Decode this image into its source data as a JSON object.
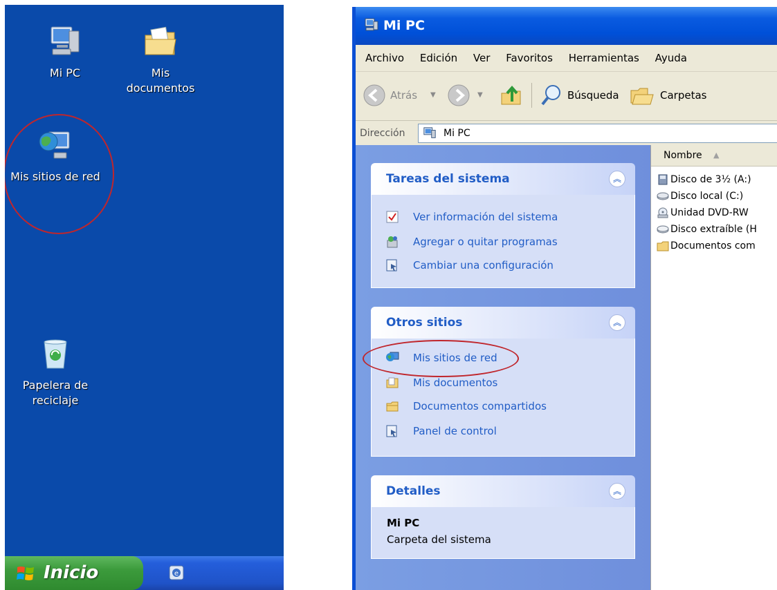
{
  "desktop": {
    "icons": [
      {
        "label": "Mi PC"
      },
      {
        "label": "Mis documentos"
      },
      {
        "label": "Mis sitios de red"
      },
      {
        "label": "Papelera de reciclaje"
      }
    ],
    "taskbar": {
      "start_label": "Inicio"
    }
  },
  "window": {
    "title": "Mi PC",
    "menu": [
      "Archivo",
      "Edición",
      "Ver",
      "Favoritos",
      "Herramientas",
      "Ayuda"
    ],
    "toolbar": {
      "back": "Atrás",
      "search": "Búsqueda",
      "folders": "Carpetas"
    },
    "address": {
      "label": "Dirección",
      "value": "Mi PC"
    },
    "taskpane": {
      "system_tasks": {
        "title": "Tareas del sistema",
        "items": [
          "Ver información del sistema",
          "Agregar o quitar programas",
          "Cambiar una configuración"
        ]
      },
      "other_places": {
        "title": "Otros sitios",
        "items": [
          "Mis sitios de red",
          "Mis documentos",
          "Documentos compartidos",
          "Panel de control"
        ]
      },
      "details": {
        "title": "Detalles",
        "name": "Mi PC",
        "description": "Carpeta del sistema"
      }
    },
    "files": {
      "column": "Nombre",
      "items": [
        "Disco de 3½ (A:)",
        "Disco local (C:)",
        "Unidad DVD-RW",
        "Disco extraíble (H",
        "Documentos com"
      ]
    }
  },
  "colors": {
    "desktop": "#0a4aaa",
    "title": "#0050d8",
    "link": "#215dc6",
    "highlight": "#c0262c"
  }
}
